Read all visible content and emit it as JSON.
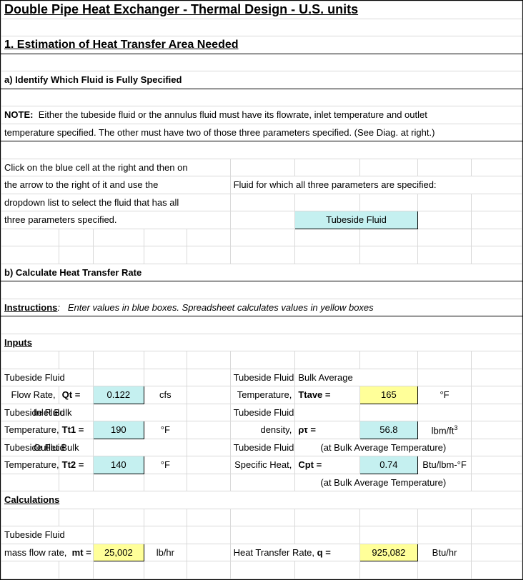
{
  "title": "Double Pipe Heat Exchanger - Thermal Design - U.S. units",
  "sec1": "1. Estimation of Heat Transfer Area Needed",
  "a_head": "a)  Identify Which Fluid is Fully Specified",
  "note_label": "NOTE:",
  "note_line1": "Either the tubeside fluid or the annulus fluid must have its flowrate, inlet temperature and outlet",
  "note_line2": " temperature specified.  The other must have two of those three parameters specified.  (See Diag. at right.)",
  "instr_click1": "Click on the blue cell at the right and then on",
  "instr_click2": "the arrow to the right of it and use the",
  "instr_click3": "dropdown list to select the fluid that has all",
  "instr_click4": "three parameters specified.",
  "fluid_prompt": "Fluid for which all three parameters are specified:",
  "fluid_choice": "Tubeside Fluid",
  "b_head": "b)  Calculate Heat Transfer Rate",
  "instructions_label": "Instructions",
  "instructions_text": "Enter values in blue boxes.  Spreadsheet calculates values in yellow boxes",
  "inputs_head": "Inputs",
  "calculations_head": "Calculations",
  "labels": {
    "tubefluid": "Tubeside Fluid",
    "flowrate": "Flow Rate,",
    "inletbulk": "Inlet Bulk",
    "outletbulk": "Outlet Bulk",
    "temperature": "Temperature,",
    "bulkavg": "Bulk Average",
    "density": "density,",
    "specheat": "Specific Heat,",
    "massflow": "mass flow rate,",
    "heattransrate": "Heat Transfer Rate,",
    "atbulk": "(at Bulk Average Temperature)"
  },
  "syms": {
    "qt": "Qt  =",
    "tt1": "Tt1  =",
    "tt2": "Tt2  =",
    "ttave": "Ttave  =",
    "rho_t": "ρτ  =",
    "cpt": "Cpt  =",
    "mt": "mt  =",
    "q": "q ="
  },
  "vals": {
    "qt": "0.122",
    "tt1": "190",
    "tt2": "140",
    "ttave": "165",
    "rho_t": "56.8",
    "cpt": "0.74",
    "mt": "25,002",
    "q": "925,082"
  },
  "units": {
    "cfs": "cfs",
    "degF": "°F",
    "lbmft3": "lbm/ft",
    "btulbmF": "Btu/lbm-°F",
    "lbhr": "lb/hr",
    "btuhr": "Btu/hr"
  }
}
